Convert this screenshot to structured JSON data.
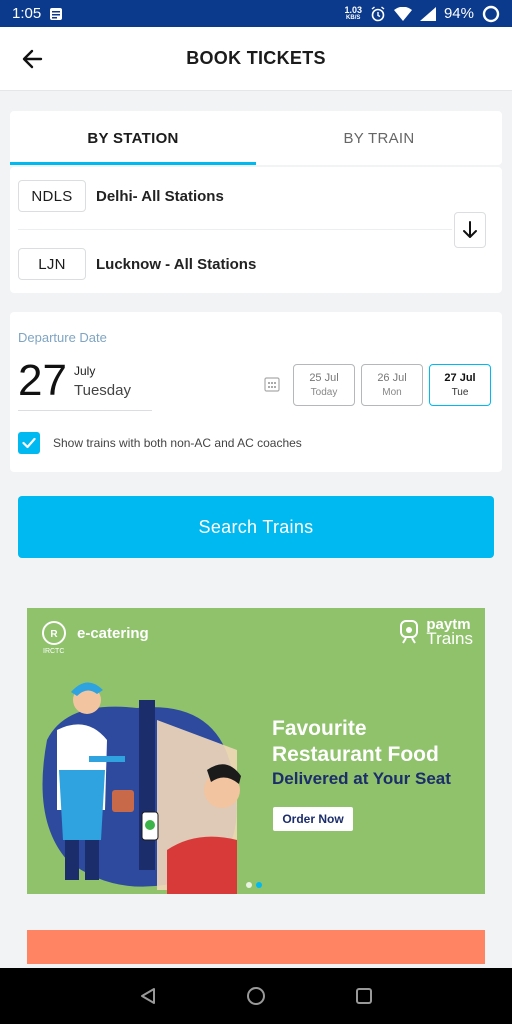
{
  "status_bar": {
    "time": "1:05",
    "net_speed": "1.03",
    "net_unit": "KB/S",
    "battery": "94%"
  },
  "app_bar": {
    "title": "BOOK TICKETS"
  },
  "tabs": [
    {
      "label": "BY STATION",
      "active": true
    },
    {
      "label": "BY TRAIN",
      "active": false
    }
  ],
  "stations": {
    "from": {
      "code": "NDLS",
      "name": "Delhi- All Stations"
    },
    "to": {
      "code": "LJN",
      "name": "Lucknow - All Stations"
    }
  },
  "departure": {
    "label": "Departure Date",
    "day": "27",
    "month": "July",
    "weekday": "Tuesday",
    "chips": [
      {
        "date": "25 Jul",
        "sub": "Today",
        "selected": false
      },
      {
        "date": "26 Jul",
        "sub": "Mon",
        "selected": false
      },
      {
        "date": "27 Jul",
        "sub": "Tue",
        "selected": true
      }
    ]
  },
  "filter": {
    "label": "Show trains with both non-AC and AC coaches",
    "checked": true
  },
  "search_button": "Search Trains",
  "banner": {
    "partner": "e-catering",
    "partner_sub": "IRCTC",
    "brand": "paytm",
    "brand_sub": "Trains",
    "headline_1": "Favourite",
    "headline_2": "Restaurant Food",
    "subline": "Delivered at Your Seat",
    "cta": "Order Now",
    "carousel_active_index": 1,
    "colors": {
      "background": "#8fc26b",
      "headline": "#ffffff",
      "subline": "#1b2d6b"
    }
  },
  "colors": {
    "accent": "#00b9f1",
    "status_bar": "#0b3a8c"
  }
}
